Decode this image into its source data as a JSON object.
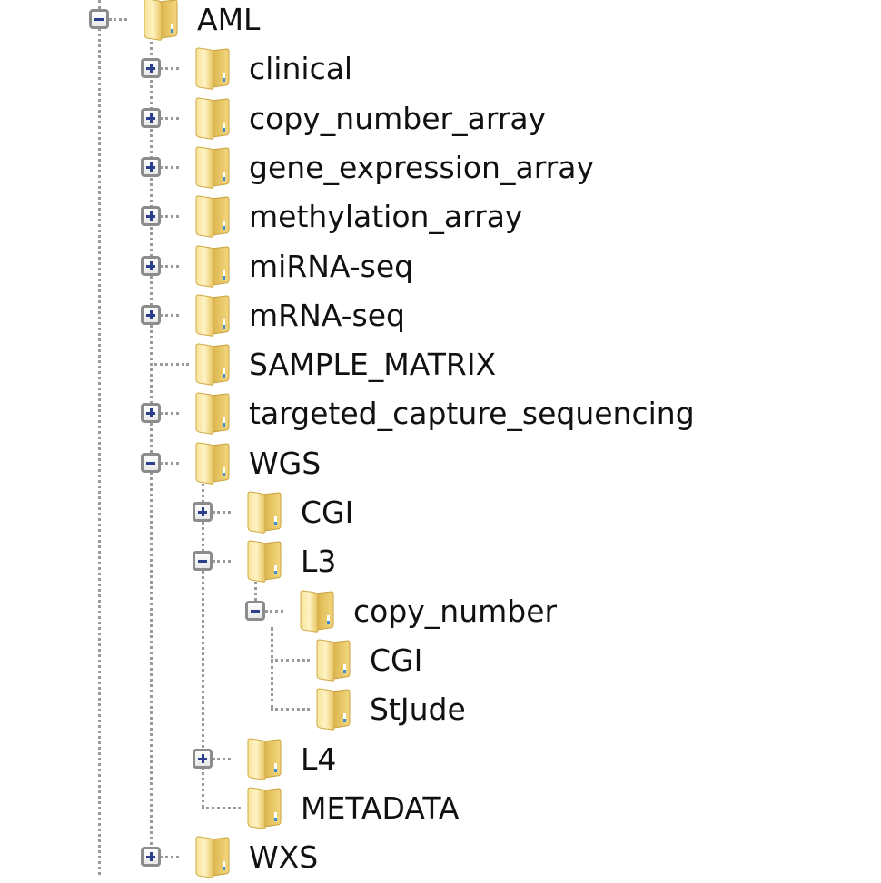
{
  "tree": {
    "root": {
      "label": "AML",
      "state": "expanded"
    },
    "items": [
      {
        "label": "clinical",
        "state": "collapsed",
        "level": 1
      },
      {
        "label": "copy_number_array",
        "state": "collapsed",
        "level": 1
      },
      {
        "label": "gene_expression_array",
        "state": "collapsed",
        "level": 1
      },
      {
        "label": "methylation_array",
        "state": "collapsed",
        "level": 1
      },
      {
        "label": "miRNA-seq",
        "state": "collapsed",
        "level": 1
      },
      {
        "label": "mRNA-seq",
        "state": "collapsed",
        "level": 1
      },
      {
        "label": "SAMPLE_MATRIX",
        "state": "leaf",
        "level": 1
      },
      {
        "label": "targeted_capture_sequencing",
        "state": "collapsed",
        "level": 1
      },
      {
        "label": "WGS",
        "state": "expanded",
        "level": 1
      },
      {
        "label": "CGI",
        "state": "collapsed",
        "level": 2
      },
      {
        "label": "L3",
        "state": "expanded",
        "level": 2
      },
      {
        "label": "copy_number",
        "state": "expanded",
        "level": 3
      },
      {
        "label": "CGI",
        "state": "leaf",
        "level": 4
      },
      {
        "label": "StJude",
        "state": "leaf",
        "level": 4
      },
      {
        "label": "L4",
        "state": "collapsed",
        "level": 2
      },
      {
        "label": "METADATA",
        "state": "leaf",
        "level": 2
      },
      {
        "label": "WXS",
        "state": "collapsed",
        "level": 1
      }
    ]
  },
  "icons": {
    "folder": "folder-icon",
    "expand": "plus-icon",
    "collapse": "minus-icon"
  }
}
